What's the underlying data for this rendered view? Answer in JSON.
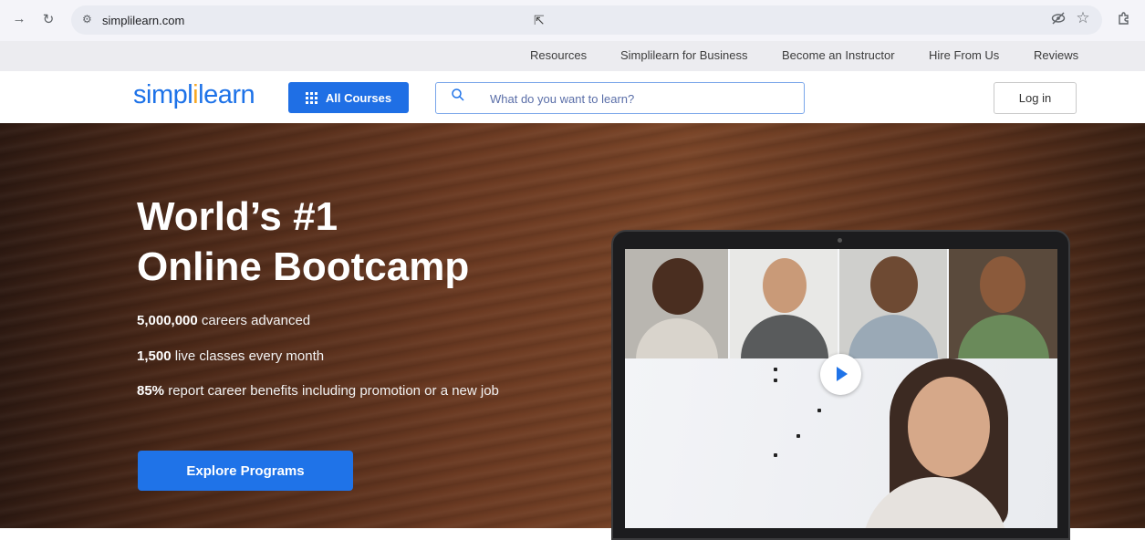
{
  "browser": {
    "url": "simplilearn.com",
    "back_icon": "arrow-right-icon",
    "reload_icon": "reload-icon",
    "site_info_icon": "tune-icon",
    "eye_icon": "eye-slash-icon",
    "star_icon": "star-icon",
    "extension_icon": "puzzle-icon"
  },
  "util_nav": {
    "items": [
      "Resources",
      "Simplilearn for Business",
      "Become an Instructor",
      "Hire From Us",
      "Reviews"
    ]
  },
  "header": {
    "logo_part1": "simpl",
    "logo_part2": "i",
    "logo_part3": "learn",
    "all_courses": "All Courses",
    "search_placeholder": "What do you want to learn?",
    "login": "Log in"
  },
  "hero": {
    "title_line1": "World’s #1",
    "title_line2": "Online Bootcamp",
    "stats": [
      {
        "value": "5,000,000",
        "text": " careers advanced"
      },
      {
        "value": "1,500",
        "text": " live classes every month"
      },
      {
        "value": "85%",
        "text": " report career benefits including promotion or a new job"
      }
    ],
    "cta": "Explore Programs"
  },
  "colors": {
    "brand_blue": "#1f73e8",
    "logo_orange": "#f7a823"
  }
}
